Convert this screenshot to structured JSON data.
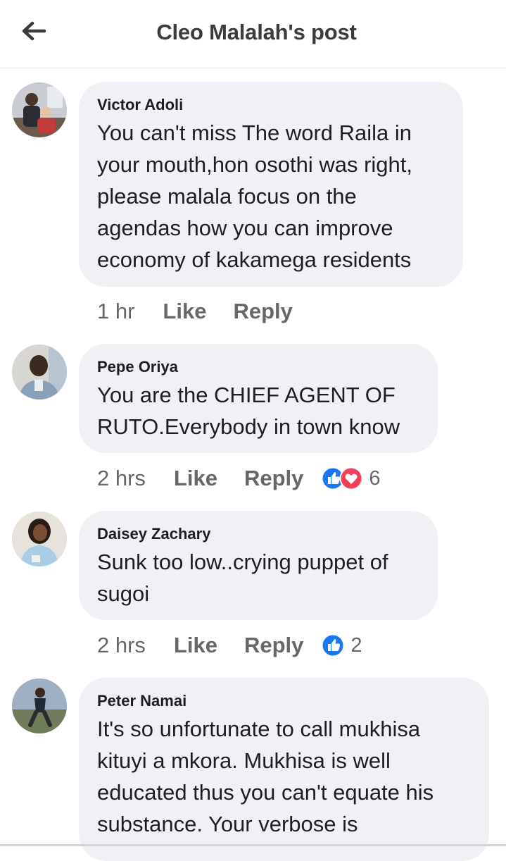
{
  "header": {
    "title": "Cleo Malalah's post",
    "back_icon": "arrow-left-icon"
  },
  "comments": [
    {
      "author": "Victor Adoli",
      "text": "You can't miss The word Raila in your mouth,hon osothi was right, please malala focus on the agendas how you can improve economy of kakamega residents",
      "lines": [
        "You can't miss The word Raila in",
        "your mouth,hon osothi was right,",
        "please malala focus on the",
        "agendas how you can improve",
        "economy of kakamega residents"
      ],
      "time": "1 hr",
      "like": "Like",
      "reply": "Reply"
    },
    {
      "author": "Pepe Oriya",
      "lines": [
        "You are the CHIEF AGENT OF",
        "RUTO.Everybody in town know"
      ],
      "time": "2 hrs",
      "like": "Like",
      "reply": "Reply",
      "reactions": {
        "types": [
          "like",
          "love"
        ],
        "count": "6"
      }
    },
    {
      "author": "Daisey Zachary",
      "lines": [
        "Sunk too low..crying puppet of",
        "sugoi"
      ],
      "time": "2 hrs",
      "like": "Like",
      "reply": "Reply",
      "reactions": {
        "types": [
          "like"
        ],
        "count": "2"
      }
    },
    {
      "author": "Peter Namai",
      "lines": [
        "It's so unfortunate to call mukhisa",
        "kituyi a mkora. Mukhisa is well",
        "educated thus you can't equate his",
        "substance. Your verbose is"
      ]
    }
  ],
  "colors": {
    "like_blue": "#1877f2",
    "love_red": "#f33e58",
    "bubble": "#eff1f4",
    "meta": "#65676b"
  }
}
